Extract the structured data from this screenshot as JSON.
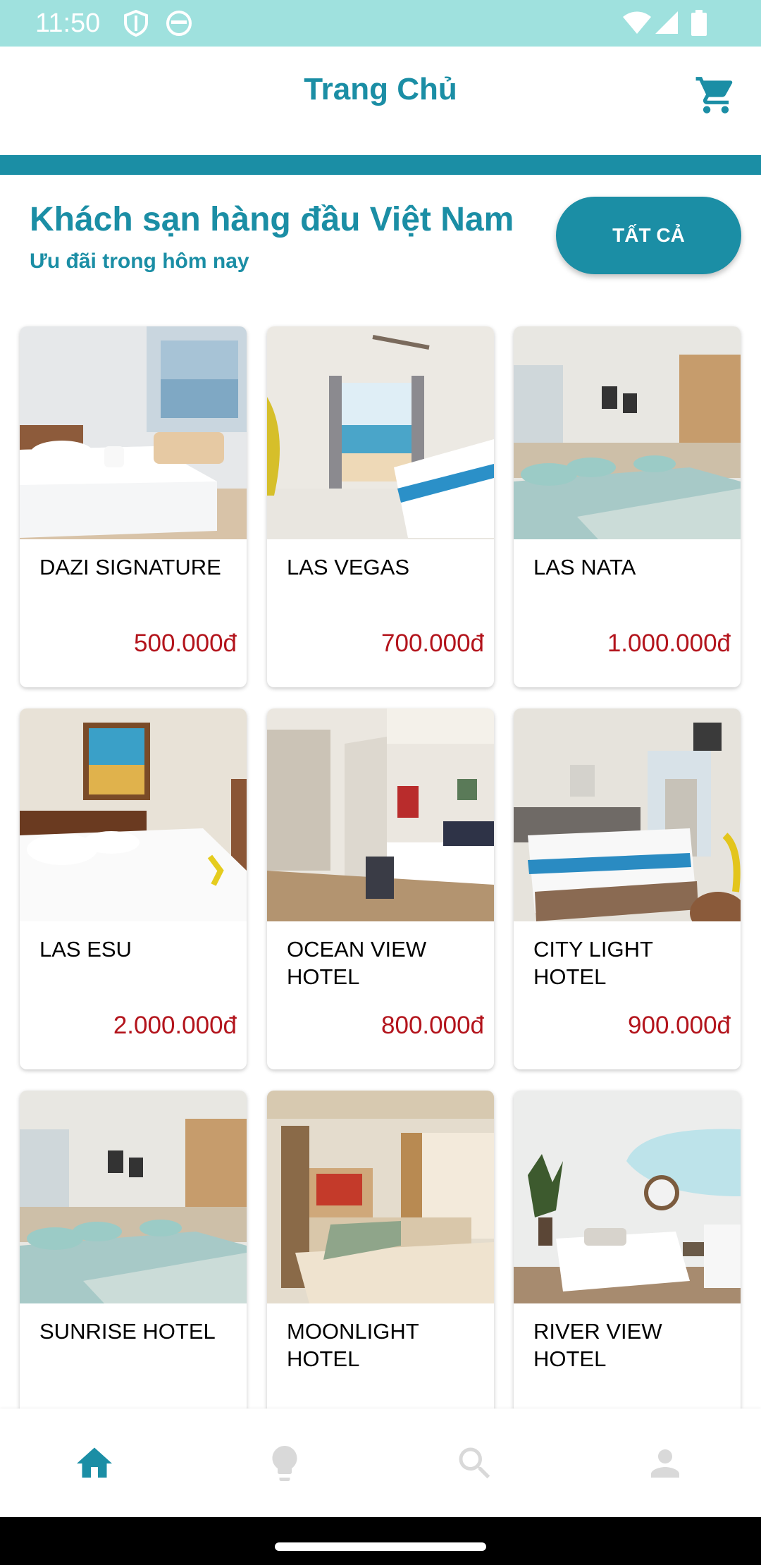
{
  "status_bar": {
    "time": "11:50"
  },
  "app_bar": {
    "title": "Trang Chủ",
    "cart_icon": "shopping-cart-icon"
  },
  "header": {
    "title": "Khách sạn hàng đầu Việt Nam",
    "subtitle": "Ưu đãi trong hôm nay",
    "all_button": "TẤT CẢ"
  },
  "colors": {
    "accent": "#1b8ea5",
    "price": "#b3141c",
    "status_bar": "#9fe1de"
  },
  "hotels": [
    {
      "name": "DAZI SIGNATURE",
      "price": "500.000đ"
    },
    {
      "name": "LAS VEGAS",
      "price": "700.000đ"
    },
    {
      "name": "LAS NATA",
      "price": "1.000.000đ"
    },
    {
      "name": "LAS ESU",
      "price": "2.000.000đ"
    },
    {
      "name": "OCEAN VIEW HOTEL",
      "price": "800.000đ"
    },
    {
      "name": "CITY LIGHT HOTEL",
      "price": "900.000đ"
    },
    {
      "name": "SUNRISE HOTEL",
      "price": ""
    },
    {
      "name": "MOONLIGHT HOTEL",
      "price": ""
    },
    {
      "name": "RIVER VIEW HOTEL",
      "price": ""
    }
  ],
  "bottom_nav": {
    "items": [
      {
        "icon": "home-icon",
        "active": true
      },
      {
        "icon": "lightbulb-icon",
        "active": false
      },
      {
        "icon": "search-icon",
        "active": false
      },
      {
        "icon": "person-icon",
        "active": false
      }
    ]
  }
}
